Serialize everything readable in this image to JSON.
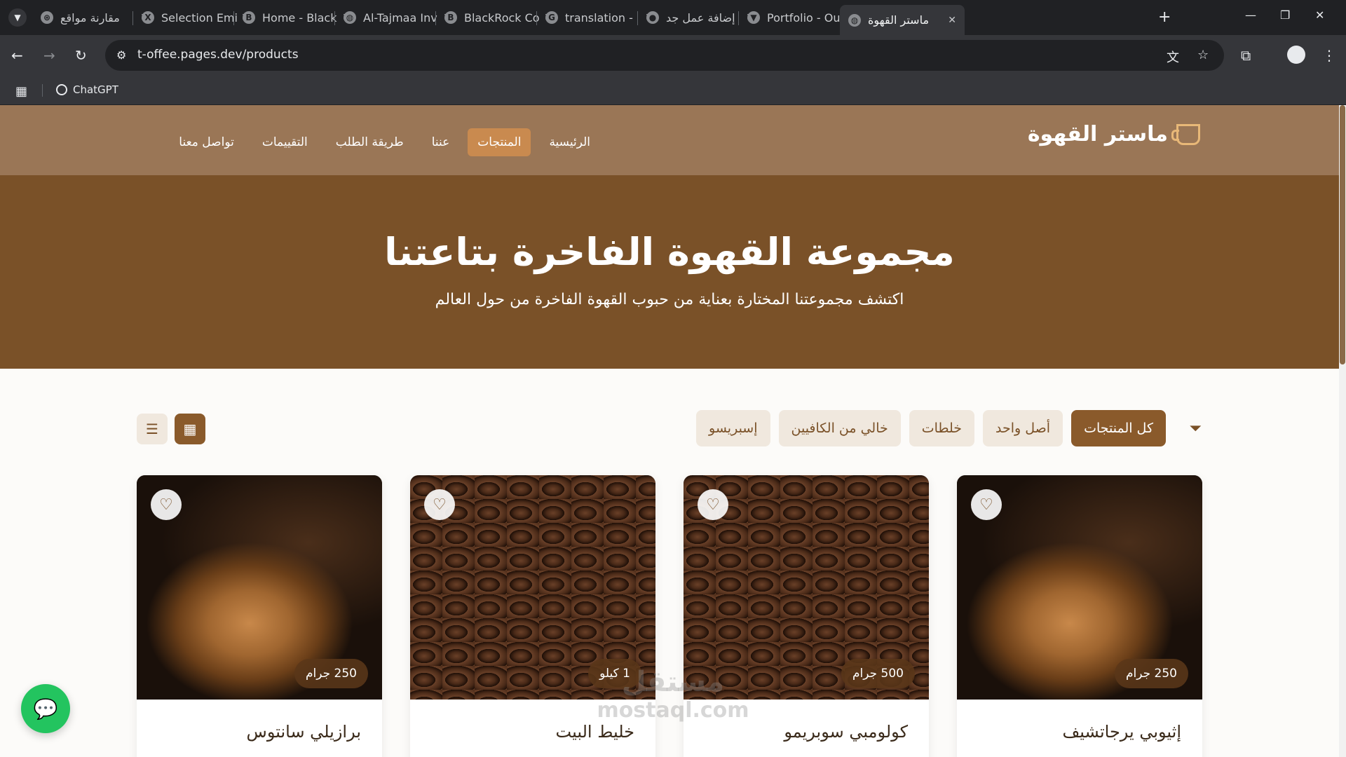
{
  "browser": {
    "tabs": [
      {
        "title": "مقارنة مواقع",
        "fav": "openai-icon",
        "active": false
      },
      {
        "title": "Selection Emi",
        "fav": "x-logo-icon",
        "active": false
      },
      {
        "title": "Home - Black",
        "fav": "b-logo-icon",
        "active": false
      },
      {
        "title": "Al-Tajmaa Inv",
        "fav": "globe-icon",
        "active": false
      },
      {
        "title": "BlackRock Co",
        "fav": "b-logo-icon",
        "active": false
      },
      {
        "title": "translation -",
        "fav": "google-icon",
        "active": false
      },
      {
        "title": "إضافة عمل جد",
        "fav": "circle-icon",
        "active": false
      },
      {
        "title": "Portfolio - Ou",
        "fav": "v-logo-icon",
        "active": false
      },
      {
        "title": "ماستر القهوة",
        "fav": "globe-icon",
        "active": true
      }
    ],
    "new_tab": "+",
    "url": "t-offee.pages.dev/products",
    "bookmarks": [
      {
        "label": "ChatGPT"
      }
    ]
  },
  "site": {
    "logo_text": "ماستر القهوة",
    "nav": [
      {
        "label": "الرئيسية",
        "active": false
      },
      {
        "label": "المنتجات",
        "active": true
      },
      {
        "label": "عننا",
        "active": false
      },
      {
        "label": "طريقة الطلب",
        "active": false
      },
      {
        "label": "التقييمات",
        "active": false
      },
      {
        "label": "تواصل معنا",
        "active": false
      }
    ],
    "hero": {
      "title": "مجموعة القهوة الفاخرة بتاعتنا",
      "subtitle": "اكتشف مجموعتنا المختارة بعناية من حبوب القهوة الفاخرة من حول العالم"
    },
    "filters": [
      {
        "label": "كل المنتجات",
        "active": true
      },
      {
        "label": "أصل واحد",
        "active": false
      },
      {
        "label": "خلطات",
        "active": false
      },
      {
        "label": "خالي من الكافيين",
        "active": false
      },
      {
        "label": "إسبريسو",
        "active": false
      }
    ],
    "products": [
      {
        "name": "إثيوبي يرجاتشيف",
        "weight": "250 جرام",
        "image": "roaster"
      },
      {
        "name": "كولومبي سوبريمو",
        "weight": "500 جرام",
        "image": "beans"
      },
      {
        "name": "خليط البيت",
        "weight": "1 كيلو",
        "image": "beans"
      },
      {
        "name": "برازيلي سانتوس",
        "weight": "250 جرام",
        "image": "roaster"
      }
    ],
    "watermark": {
      "line1": "مستقل",
      "line2": "mostaql.com"
    }
  },
  "colors": {
    "header_bg": "#9a7656",
    "hero_bg": "#7a5128",
    "accent": "#8a5a2b",
    "nav_active": "#c98a4f",
    "chat_fab": "#23c45f"
  }
}
